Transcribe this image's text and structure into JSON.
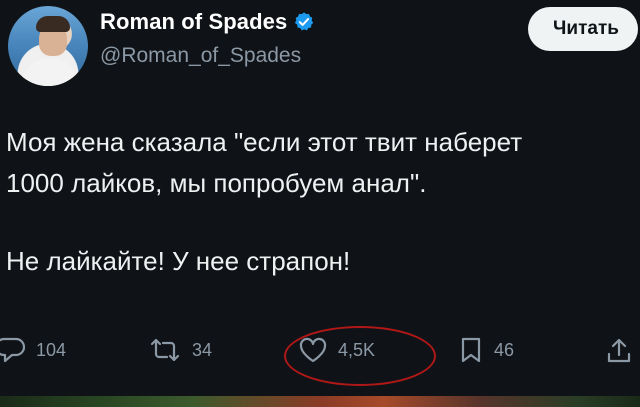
{
  "user": {
    "name": "Roman of Spades",
    "handle": "@Roman_of_Spades",
    "verified": true,
    "avatar": "avatar-photo"
  },
  "follow_button": {
    "label": "Читать"
  },
  "tweet": {
    "lines": [
      "Моя жена сказала \"если этот твит наберет",
      "1000 лайков, мы попробуем анал\".",
      "Не лайкайте! У нее страпон!"
    ]
  },
  "actions": {
    "reply": {
      "icon": "reply-icon",
      "count": "104"
    },
    "retweet": {
      "icon": "retweet-icon",
      "count": "34"
    },
    "like": {
      "icon": "heart-icon",
      "count": "4,5K"
    },
    "bookmark": {
      "icon": "bookmark-icon",
      "count": "46"
    },
    "share": {
      "icon": "share-icon"
    }
  },
  "colors": {
    "background": "#0f1216",
    "text": "#e7e9ea",
    "muted": "#8b98a5",
    "verified": "#1d9bf0",
    "annotation_circle": "#b01818"
  }
}
